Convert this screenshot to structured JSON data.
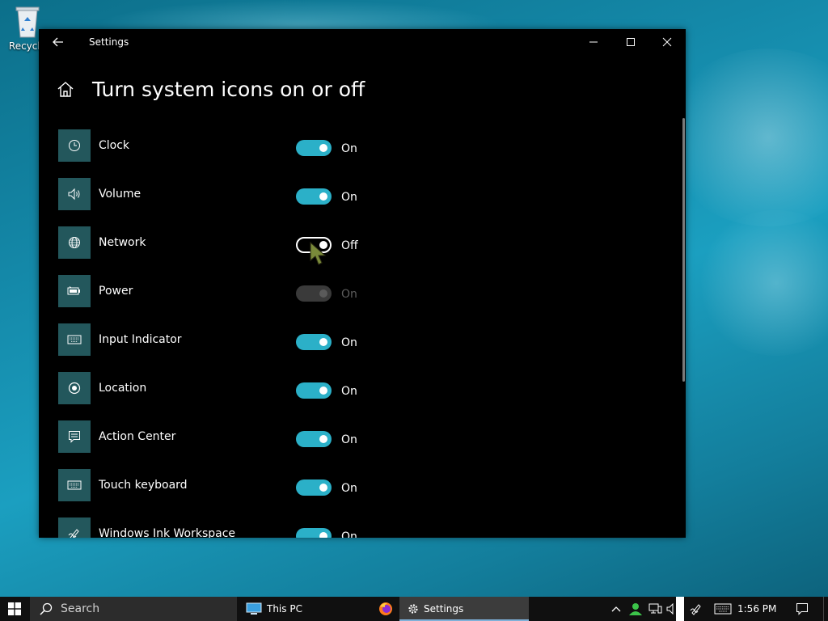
{
  "desktop": {
    "recycle_bin_label": "Recycle"
  },
  "window": {
    "title": "Settings",
    "page_title": "Turn system icons on or off"
  },
  "items": [
    {
      "label": "Clock",
      "state": "On",
      "enabled": true,
      "on": true,
      "icon": "clock-icon"
    },
    {
      "label": "Volume",
      "state": "On",
      "enabled": true,
      "on": true,
      "icon": "volume-icon"
    },
    {
      "label": "Network",
      "state": "Off",
      "enabled": true,
      "on": false,
      "icon": "globe-icon"
    },
    {
      "label": "Power",
      "state": "On",
      "enabled": false,
      "on": true,
      "icon": "battery-icon"
    },
    {
      "label": "Input Indicator",
      "state": "On",
      "enabled": true,
      "on": true,
      "icon": "keyboard-icon"
    },
    {
      "label": "Location",
      "state": "On",
      "enabled": true,
      "on": true,
      "icon": "location-icon"
    },
    {
      "label": "Action Center",
      "state": "On",
      "enabled": true,
      "on": true,
      "icon": "action-center-icon"
    },
    {
      "label": "Touch keyboard",
      "state": "On",
      "enabled": true,
      "on": true,
      "icon": "touch-keyboard-icon"
    },
    {
      "label": "Windows Ink Workspace",
      "state": "On",
      "enabled": true,
      "on": true,
      "icon": "pen-icon"
    }
  ],
  "taskbar": {
    "search_placeholder": "Search",
    "this_pc_label": "This PC",
    "settings_label": "Settings",
    "clock": "1:56 PM"
  },
  "colors": {
    "accent": "#2bb0c8",
    "tile": "#23575c",
    "window_bg": "#000000"
  }
}
